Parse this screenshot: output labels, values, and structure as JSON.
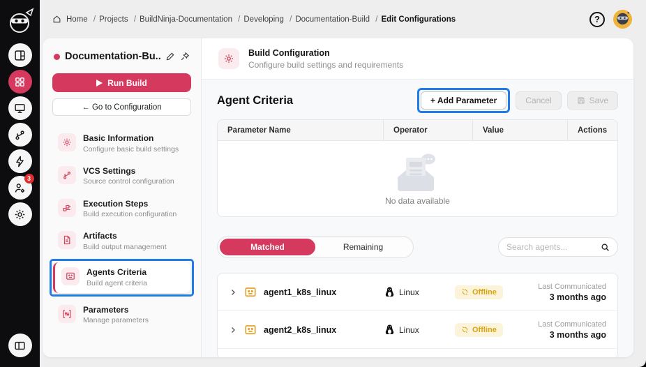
{
  "colors": {
    "accent": "#d5395e",
    "highlight_blue": "#217be8",
    "offline_text": "#d9a40f",
    "offline_bg": "#fcf4da",
    "agent_icon_orange": "#e2a32b",
    "rail_bg": "#0d0d0f"
  },
  "sidebar": {
    "badge_count": "3",
    "icons": [
      "ninja-logo",
      "dashboard",
      "apps-grid",
      "monitor",
      "git-branch",
      "lightning",
      "user-gear",
      "settings-gear",
      "panel-toggle"
    ]
  },
  "topbar": {
    "breadcrumb": [
      "Home",
      "Projects",
      "BuildNinja-Documentation",
      "Developing",
      "Documentation-Build",
      "Edit Configurations"
    ],
    "help_glyph": "?"
  },
  "panel": {
    "title": "Documentation-Bu...",
    "run_label": "Run Build",
    "goto_label": "← Go to Configuration",
    "menu": [
      {
        "label": "Basic Information",
        "sublabel": "Configure basic build settings",
        "icon": "gear-icon"
      },
      {
        "label": "VCS Settings",
        "sublabel": "Source control configuration",
        "icon": "branch-icon"
      },
      {
        "label": "Execution Steps",
        "sublabel": "Build execution configuration",
        "icon": "steps-icon"
      },
      {
        "label": "Artifacts",
        "sublabel": "Build output management",
        "icon": "document-icon"
      },
      {
        "label": "Agents Criteria",
        "sublabel": "Build agent criteria",
        "icon": "agent-screen-icon"
      },
      {
        "label": "Parameters",
        "sublabel": "Manage parameters",
        "icon": "sliders-icon"
      }
    ]
  },
  "main": {
    "header": {
      "title": "Build Configuration",
      "subtitle": "Configure build settings and requirements"
    },
    "section_title": "Agent Criteria",
    "actions": {
      "add": "+ Add Parameter",
      "cancel": "Cancel",
      "save": "Save"
    },
    "table": {
      "columns": [
        "Parameter Name",
        "Operator",
        "Value",
        "Actions"
      ],
      "empty_text": "No data available"
    },
    "tabs": [
      {
        "label": "Matched",
        "active": true
      },
      {
        "label": "Remaining",
        "active": false
      }
    ],
    "search_placeholder": "Search agents...",
    "agents": [
      {
        "name": "agent1_k8s_linux",
        "os": "Linux",
        "status": "Offline",
        "last_label": "Last Communicated",
        "last_value": "3 months ago"
      },
      {
        "name": "agent2_k8s_linux",
        "os": "Linux",
        "status": "Offline",
        "last_label": "Last Communicated",
        "last_value": "3 months ago"
      }
    ]
  }
}
